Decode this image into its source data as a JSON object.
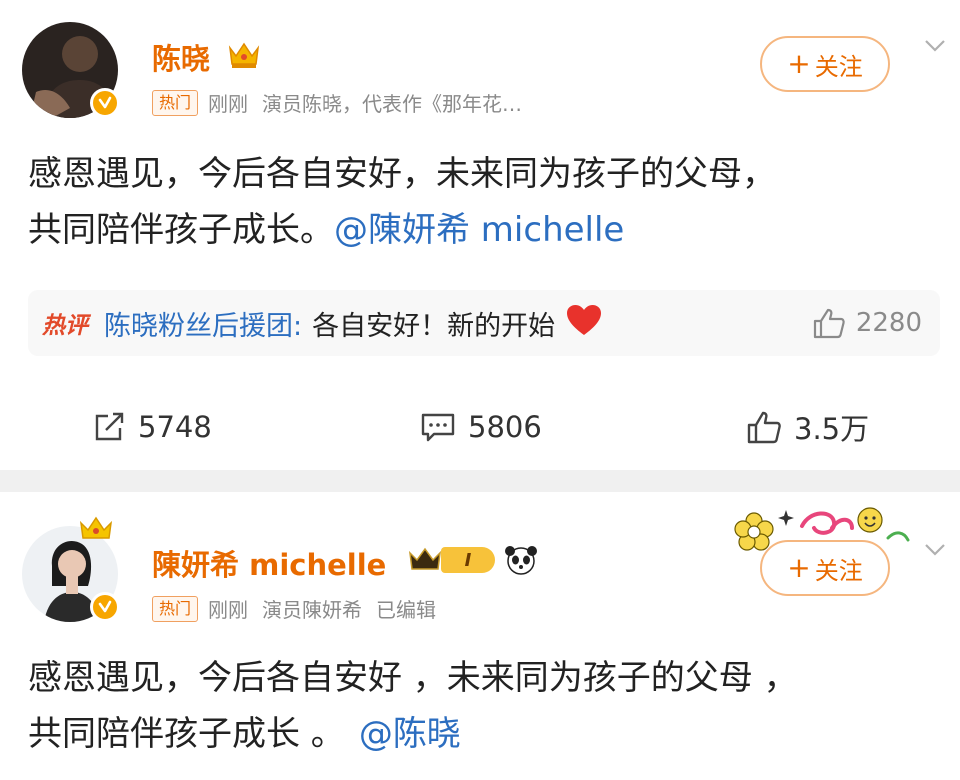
{
  "post1": {
    "username": "陈晓",
    "hot_tag": "热门",
    "time": "刚刚",
    "description": "演员陈晓，代表作《那年花…",
    "follow_label": "关注",
    "follow_plus": "+",
    "content_line1": "感恩遇见，今后各自安好，未来同为孩子的父母，",
    "content_line2_text": "共同陪伴孩子成长。",
    "content_mention": "@陳妍希 michelle",
    "hot_comment": {
      "tag": "热评",
      "user": "陈晓粉丝后援团:",
      "text": "各自安好！新的开始",
      "likes": "2280"
    },
    "actions": {
      "repost": "5748",
      "comment": "5806",
      "like": "3.5万"
    }
  },
  "post2": {
    "username": "陳妍希 michelle",
    "hot_tag": "热门",
    "time": "刚刚",
    "description": "演员陳妍希",
    "edited": "已编辑",
    "follow_label": "关注",
    "follow_plus": "+",
    "content_line1": "感恩遇见，今后各自安好 ，未来同为孩子的父母 ，",
    "content_line2_text": "共同陪伴孩子成长 。",
    "content_mention": "@陈晓",
    "level_badge": "I"
  },
  "colors": {
    "username": "#e86a00",
    "mention": "#2c6ec0",
    "hot_comment_tag": "#e24a2a",
    "separator": "#f0f0f0"
  },
  "icons": [
    "crown-icon",
    "verified-badge-icon",
    "chevron-down-icon",
    "heart-icon",
    "thumbs-up-icon",
    "repost-icon",
    "comment-icon",
    "panda-icon",
    "flower-sticker-icon"
  ]
}
